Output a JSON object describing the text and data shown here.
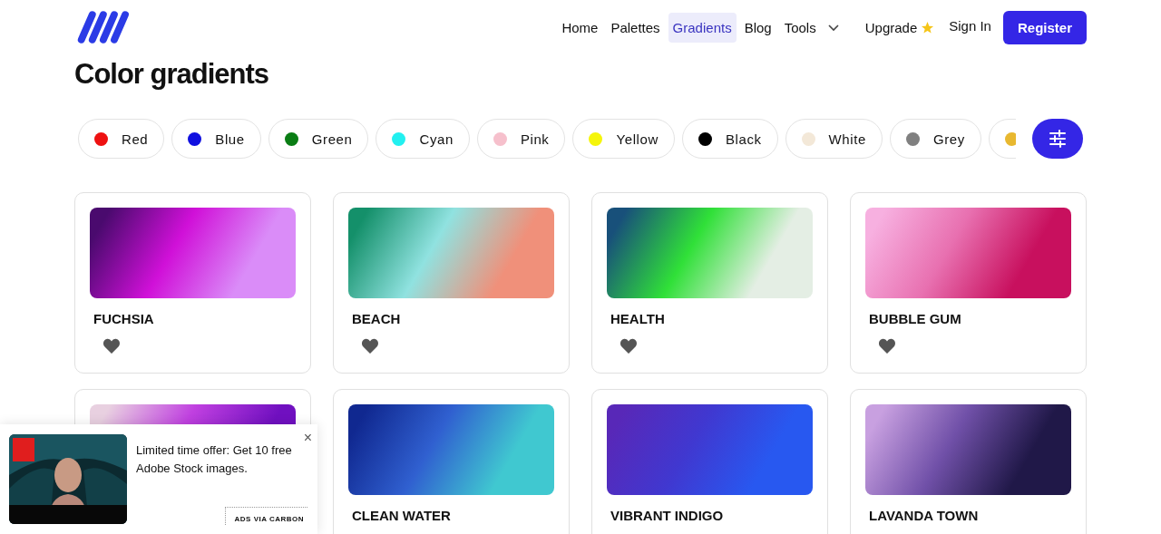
{
  "nav": {
    "items": [
      {
        "label": "Home",
        "selected": false
      },
      {
        "label": "Palettes",
        "selected": false
      },
      {
        "label": "Gradients",
        "selected": true
      },
      {
        "label": "Blog",
        "selected": false
      },
      {
        "label": "Tools",
        "selected": false,
        "dropdown": true
      },
      {
        "label": "Upgrade",
        "selected": false,
        "star": true
      }
    ],
    "sign_in": "Sign In",
    "register": "Register"
  },
  "title": "Color gradients",
  "chips": [
    {
      "label": "Red",
      "color": "#ee1111"
    },
    {
      "label": "Blue",
      "color": "#1010e0"
    },
    {
      "label": "Green",
      "color": "#0a7d14"
    },
    {
      "label": "Cyan",
      "color": "#22f0f0"
    },
    {
      "label": "Pink",
      "color": "#f6c0cc"
    },
    {
      "label": "Yellow",
      "color": "#f5f50a"
    },
    {
      "label": "Black",
      "color": "#000000"
    },
    {
      "label": "White",
      "color": "#f3e8d8"
    },
    {
      "label": "Grey",
      "color": "#808080"
    },
    {
      "color": "#e8b830"
    }
  ],
  "cards": [
    {
      "name": "FUCHSIA",
      "stops": [
        {
          "color": "#4a0a6e"
        },
        {
          "color": "#d010d8"
        },
        {
          "color": "#da8cf8"
        }
      ],
      "heart": true
    },
    {
      "name": "BEACH",
      "stops": [
        {
          "color": "#14906a"
        },
        {
          "color": "#90e2e0"
        },
        {
          "color": "#f0907a"
        }
      ],
      "heart": true
    },
    {
      "name": "HEALTH",
      "stops": [
        {
          "color": "#18507a"
        },
        {
          "color": "#30e038"
        },
        {
          "color": "#e4eee4"
        }
      ],
      "heart": true
    },
    {
      "name": "BUBBLE GUM",
      "stops": [
        {
          "color": "#f7b0e0"
        },
        {
          "color": "#e870b0"
        },
        {
          "color": "#c8105e"
        }
      ],
      "heart": true
    },
    {
      "stops": [
        {
          "color": "#e8d0e0"
        },
        {
          "color": "#c040e0"
        },
        {
          "color": "#7010c0"
        }
      ],
      "heart": false
    },
    {
      "name": "CLEAN WATER",
      "stops": [
        {
          "color": "#102890"
        },
        {
          "color": "#3060d0"
        },
        {
          "color": "#40c8d0"
        }
      ],
      "heart": false
    },
    {
      "name": "VIBRANT INDIGO",
      "stops": [
        {
          "color": "#5828b8"
        },
        {
          "color": "#4038d0"
        },
        {
          "color": "#2858f0"
        }
      ],
      "heart": false
    },
    {
      "name": "LAVANDA TOWN",
      "stops": [
        {
          "color": "#c8a0e0"
        },
        {
          "color": "#7050a8"
        },
        {
          "color": "#201848"
        }
      ],
      "heart": false
    }
  ],
  "ad": {
    "text": "Limited time offer: Get 10 free Adobe Stock images.",
    "footer": "ADS VIA CARBON",
    "close": "×"
  }
}
